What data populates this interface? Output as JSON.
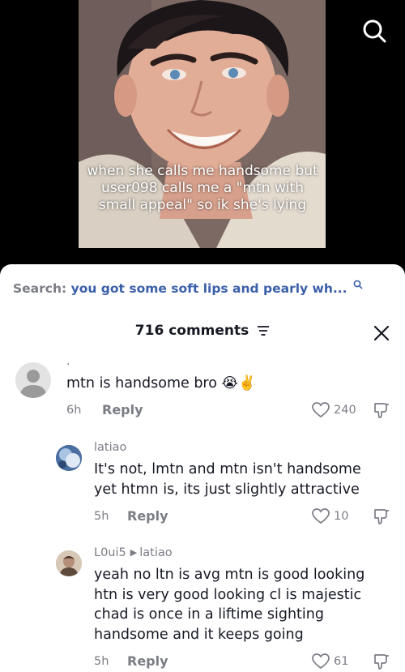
{
  "video": {
    "caption": "when she calls me handsome but user098 calls me a \"mtn with small appeal\" so ik she's lying",
    "search_icon": "search-icon"
  },
  "sheet": {
    "search_label": "Search:",
    "search_query": "you got some soft lips and pearly wh...",
    "comments_count": "716 comments",
    "filter_icon": "filter-icon",
    "close_icon": "close-icon"
  },
  "comments": [
    {
      "username": ".",
      "text": "mtn is handsome bro 😭✌️",
      "time": "6h",
      "reply_label": "Reply",
      "likes": "240"
    },
    {
      "username": "latiao",
      "text": "It's not, lmtn and mtn isn't handsome yet htmn is, its just slightly attractive",
      "time": "5h",
      "reply_label": "Reply",
      "likes": "10"
    },
    {
      "username": "L0ui5",
      "reply_to": "latiao",
      "text": "yeah no ltn is avg mtn is good looking htn is very good looking cl is majestic chad is once in a liftime sighting handsome and it keeps going",
      "time": "5h",
      "reply_label": "Reply",
      "likes": "61"
    }
  ],
  "colors": {
    "secondary_text": "#7b7d85",
    "query_link": "#3a5fa8",
    "primary_text": "#161823"
  }
}
